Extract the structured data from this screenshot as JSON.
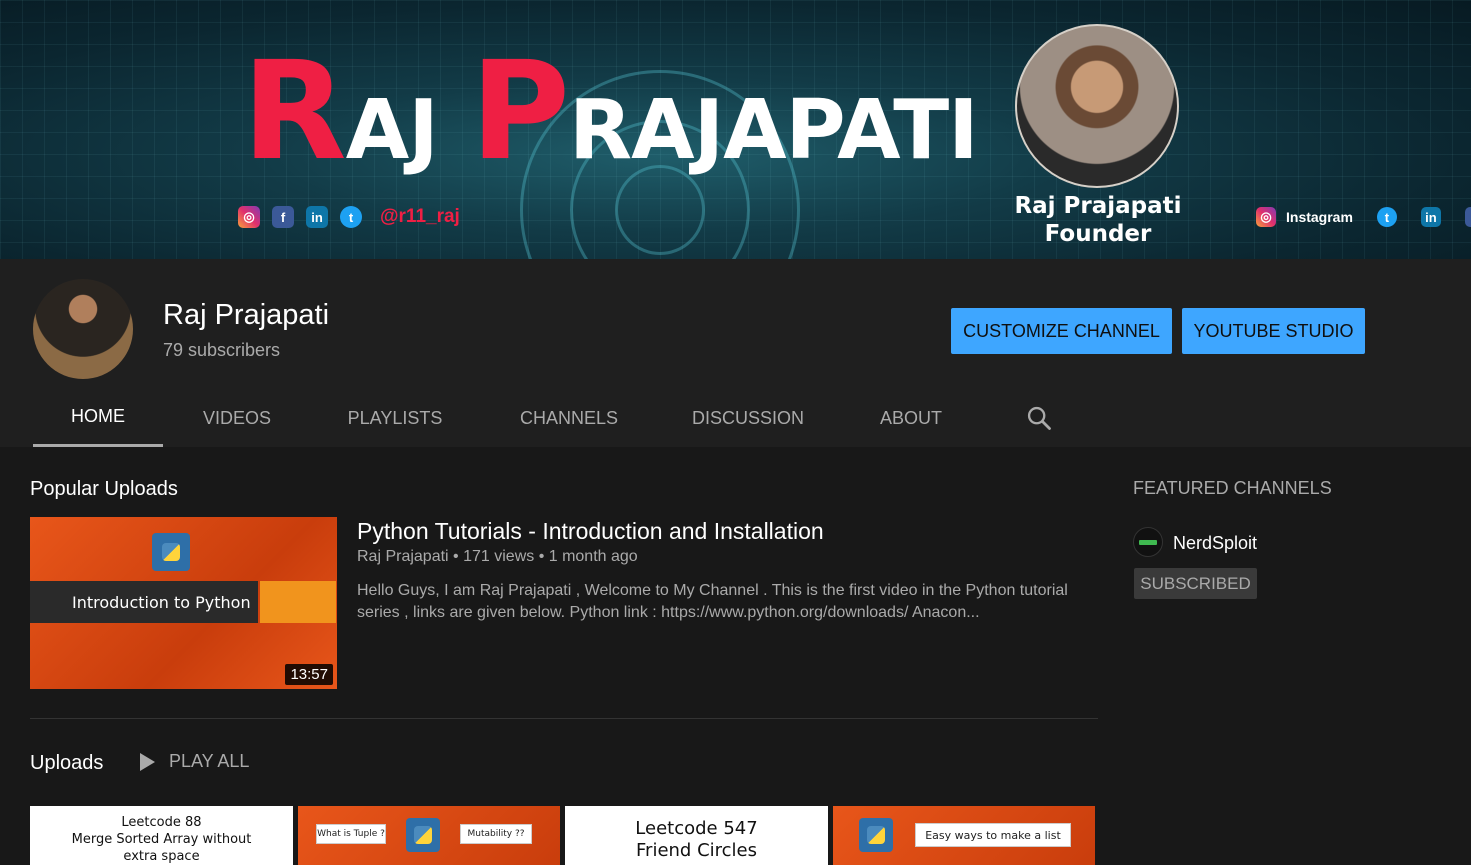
{
  "banner": {
    "title_r": "R",
    "title_aj": "AJ",
    "title_p": "P",
    "title_rajapati": "RAJAPATI",
    "handle": "@r11_raj",
    "founder_name": "Raj Prajapati",
    "founder_role": "Founder",
    "instagram_label": "Instagram"
  },
  "channel": {
    "name": "Raj Prajapati",
    "subscribers": "79 subscribers",
    "customize_label": "CUSTOMIZE CHANNEL",
    "studio_label": "YOUTUBE STUDIO"
  },
  "tabs": [
    {
      "label": "HOME",
      "active": true
    },
    {
      "label": "VIDEOS"
    },
    {
      "label": "PLAYLISTS"
    },
    {
      "label": "CHANNELS"
    },
    {
      "label": "DISCUSSION"
    },
    {
      "label": "ABOUT"
    }
  ],
  "popular": {
    "section_title": "Popular Uploads",
    "thumb_text": "Introduction to Python",
    "duration": "13:57",
    "title": "Python Tutorials - Introduction and Installation",
    "meta": "Raj Prajapati • 171 views • 1 month ago",
    "description": "Hello Guys, I am Raj Prajapati , Welcome to My Channel . This is the first video in the Python tutorial series , links are given below. Python link : https://www.python.org/downloads/ Anacon..."
  },
  "uploads": {
    "section_title": "Uploads",
    "play_all_label": "PLAY ALL",
    "items": [
      {
        "text": "Leetcode 88\nMerge Sorted Array without\nextra space"
      },
      {
        "label_a": "What is Tuple ?",
        "label_b": "Mutability ??"
      },
      {
        "text": "Leetcode 547\nFriend Circles"
      },
      {
        "label_a": "Easy ways to make a list"
      }
    ]
  },
  "featured": {
    "title": "FEATURED CHANNELS",
    "channel_name": "NerdSploit",
    "subscribed_label": "SUBSCRIBED"
  }
}
